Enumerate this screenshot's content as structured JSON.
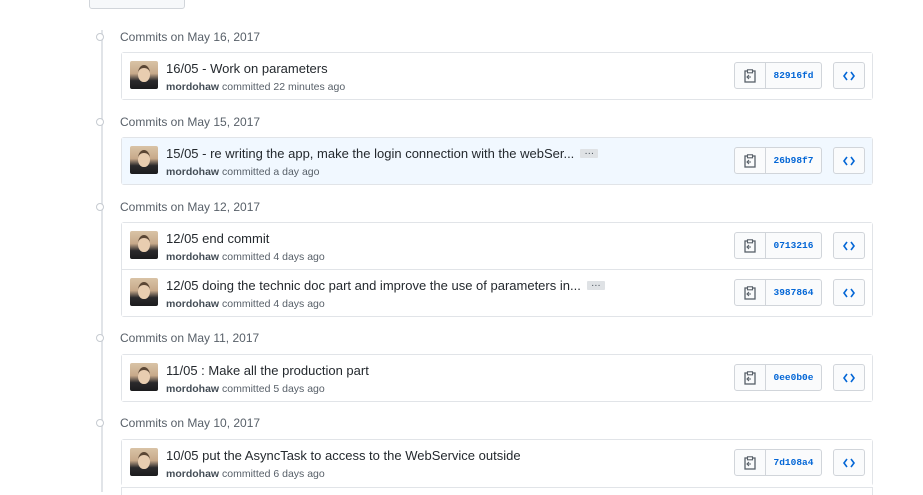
{
  "groups": [
    {
      "title": "Commits on May 16, 2017",
      "commits": [
        {
          "message": "16/05 - Work on parameters",
          "author": "mordohaw",
          "committed": "committed 22 minutes ago",
          "sha": "82916fd",
          "has_ellipsis": false,
          "highlight": false
        }
      ]
    },
    {
      "title": "Commits on May 15, 2017",
      "commits": [
        {
          "message": "15/05 - re writing the app, make the login connection with the webSer...",
          "author": "mordohaw",
          "committed": "committed a day ago",
          "sha": "26b98f7",
          "has_ellipsis": true,
          "highlight": true
        }
      ]
    },
    {
      "title": "Commits on May 12, 2017",
      "commits": [
        {
          "message": "12/05 end commit",
          "author": "mordohaw",
          "committed": "committed 4 days ago",
          "sha": "0713216",
          "has_ellipsis": false,
          "highlight": false
        },
        {
          "message": "12/05 doing the technic doc part and improve the use of parameters in...",
          "author": "mordohaw",
          "committed": "committed 4 days ago",
          "sha": "3987864",
          "has_ellipsis": true,
          "highlight": false
        }
      ]
    },
    {
      "title": "Commits on May 11, 2017",
      "commits": [
        {
          "message": "11/05 : Make all the production part",
          "author": "mordohaw",
          "committed": "committed 5 days ago",
          "sha": "0ee0b0e",
          "has_ellipsis": false,
          "highlight": false
        }
      ]
    },
    {
      "title": "Commits on May 10, 2017",
      "commits": [
        {
          "message": "10/05 put the AsyncTask to access to the WebService outside",
          "author": "mordohaw",
          "committed": "committed 6 days ago",
          "sha": "7d108a4",
          "has_ellipsis": false,
          "highlight": false
        }
      ]
    }
  ],
  "ellipsis_label": "…",
  "icons": {
    "copy": "clipboard-icon",
    "browse": "code-icon",
    "dot": "timeline-dot-icon"
  },
  "colors": {
    "link": "#0366d6",
    "highlight_bg": "#f1f8ff",
    "border": "#e1e4e8"
  }
}
